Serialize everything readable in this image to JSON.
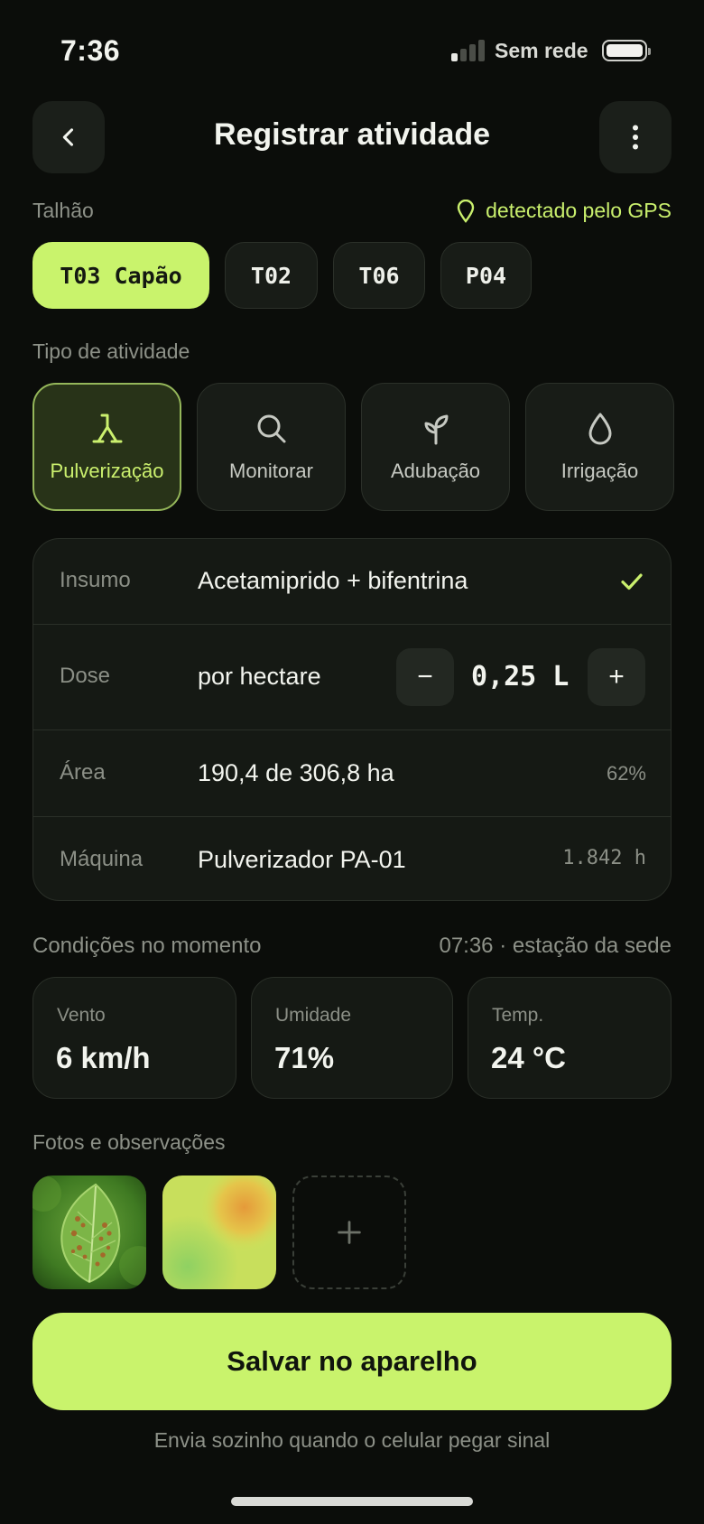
{
  "status": {
    "time": "7:36",
    "network": "Sem rede",
    "signal_bars_on": 1,
    "battery_level": 0.9
  },
  "header": {
    "title": "Registrar atividade",
    "back_icon": "chevron-left-icon",
    "more_icon": "more-vertical-icon"
  },
  "plot_section": {
    "label": "Talhão",
    "gps_text": "detectado pelo GPS",
    "plots": [
      "T03 Capão",
      "T02",
      "T06",
      "P04"
    ],
    "selected": "T03 Capão"
  },
  "activity_section": {
    "label": "Tipo de atividade",
    "types": [
      {
        "label": "Pulverização",
        "icon": "sprayer-icon"
      },
      {
        "label": "Monitorar",
        "icon": "search-icon"
      },
      {
        "label": "Adubação",
        "icon": "sprout-icon"
      },
      {
        "label": "Irrigação",
        "icon": "droplet-icon"
      }
    ],
    "selected": "Pulverização"
  },
  "details": {
    "input": {
      "label": "Insumo",
      "value": "Acetamiprido + bifentrina"
    },
    "dose": {
      "label": "Dose",
      "unit_text": "por hectare",
      "value": "0,25 L",
      "minus": "−",
      "plus": "+"
    },
    "area": {
      "label": "Área",
      "value": "190,4 de 306,8 ha",
      "percent": "62%"
    },
    "machine": {
      "label": "Máquina",
      "value": "Pulverizador PA-01",
      "hours": "1.842 h"
    }
  },
  "conditions": {
    "label": "Condições no momento",
    "time_source": "07:36 · estação da sede",
    "items": [
      {
        "label": "Vento",
        "value": "6 km/h"
      },
      {
        "label": "Umidade",
        "value": "71%"
      },
      {
        "label": "Temp.",
        "value": "24 °C"
      }
    ]
  },
  "photos": {
    "label": "Fotos e observações",
    "add_label": "+"
  },
  "actions": {
    "save_label": "Salvar no aparelho",
    "note": "Envia sozinho quando o celular pegar sinal"
  },
  "colors": {
    "accent": "#c9f36c",
    "background": "#0b0d0a",
    "card": "#151914"
  }
}
